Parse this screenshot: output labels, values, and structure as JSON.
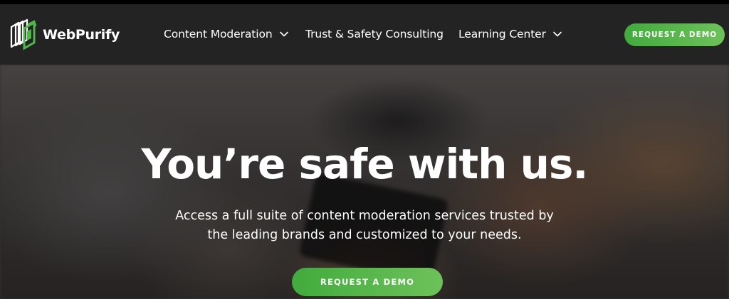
{
  "header": {
    "logo": {
      "name_part1": "Web",
      "name_part2": "Purify",
      "icon": "webpurify-logo-icon",
      "colors": {
        "outline": "#ffffff",
        "accent": "#4db848"
      }
    },
    "nav": {
      "content_moderation": {
        "label": "Content Moderation",
        "icon": "chevron-down-icon"
      },
      "trust_safety": {
        "label": "Trust & Safety Consulting"
      },
      "learning_center": {
        "label": "Learning Center",
        "icon": "chevron-down-icon"
      }
    },
    "cta": {
      "label": "REQUEST A DEMO"
    }
  },
  "hero": {
    "title": "You’re safe with us.",
    "subtitle_line1": "Access a full suite of content moderation services trusted by",
    "subtitle_line2": "the leading brands and customized to your needs.",
    "cta": {
      "label": "REQUEST A DEMO"
    }
  },
  "colors": {
    "navbar_bg": "#232323",
    "brand_green": "#4db848",
    "text": "#ffffff"
  }
}
